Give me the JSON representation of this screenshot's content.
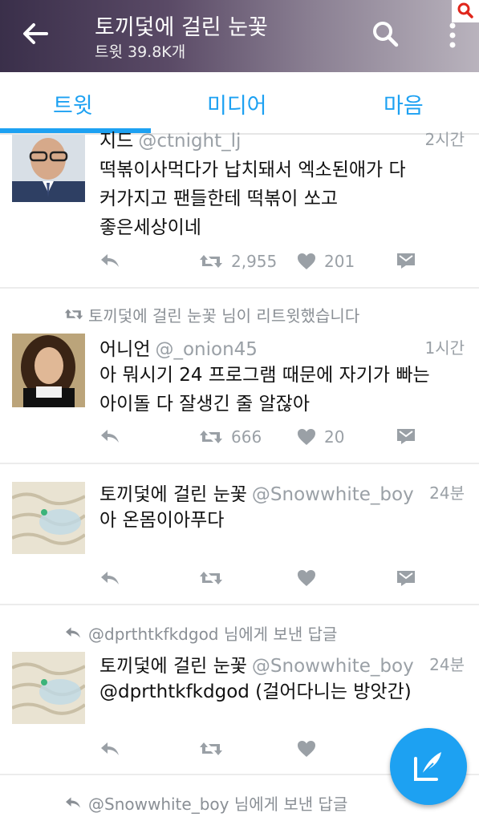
{
  "header": {
    "title": "토끼덫에 걸린 눈꽃",
    "subtitle": "트윗 39.8K개",
    "back_icon": "arrow-left-icon",
    "search_icon": "search-icon",
    "more_icon": "more-vertical-icon"
  },
  "tabs": [
    {
      "label": "트윗",
      "active": true
    },
    {
      "label": "미디어",
      "active": false
    },
    {
      "label": "마음",
      "active": false
    }
  ],
  "tweets": [
    {
      "name": "지드",
      "handle": "@ctnight_lj",
      "time": "2시간",
      "text": [
        "떡볶이사먹다가 납치돼서 엑소된애가 다",
        "커가지고 팬들한테 떡볶이 쏘고",
        "좋은세상이네"
      ],
      "retweets": "2,955",
      "likes": "201"
    },
    {
      "context": "토끼덫에 걸린 눈꽃 님이 리트윗했습니다",
      "name": "어니언",
      "handle": "@_onion45",
      "time": "1시간",
      "text": [
        "아 뭐시기 24 프로그램 때문에 자기가 빠는",
        "아이돌 다 잘생긴 줄 알잖아"
      ],
      "retweets": "666",
      "likes": "20"
    },
    {
      "name": "토끼덫에 걸린 눈꽃",
      "handle": "@Snowwhite_boy",
      "time": "24분",
      "text": [
        "아 온몸이아푸다"
      ]
    },
    {
      "context": "@dprthtkfkdgod 님에게 보낸 답글",
      "name": "토끼덫에 걸린 눈꽃",
      "handle": "@Snowwhite_boy",
      "time": "24분",
      "text": [
        "@dprthtkfkdgod (걸어다니는 방앗간)"
      ]
    },
    {
      "context": "@Snowwhite_boy 님에게 보낸 답글"
    }
  ],
  "colors": {
    "accent": "#1da1f2",
    "muted": "#9aa0a6"
  },
  "fab_icon": "compose-icon"
}
